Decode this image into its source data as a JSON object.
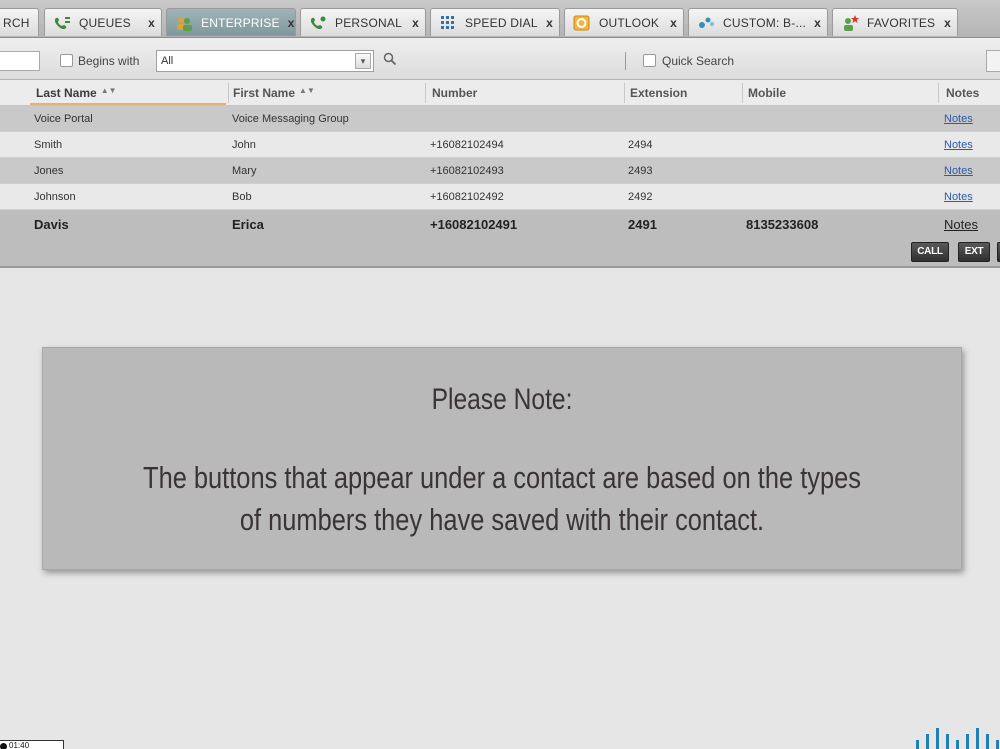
{
  "tabs": [
    {
      "label": "RCH",
      "icon": "search-icon",
      "active": false
    },
    {
      "label": "QUEUES",
      "icon": "queue-phone-icon",
      "active": false
    },
    {
      "label": "ENTERPRISE",
      "icon": "enterprise-people-icon",
      "active": true
    },
    {
      "label": "PERSONAL",
      "icon": "personal-phone-icon",
      "active": false
    },
    {
      "label": "SPEED DIAL",
      "icon": "keypad-icon",
      "active": false
    },
    {
      "label": "OUTLOOK",
      "icon": "outlook-icon",
      "active": false
    },
    {
      "label": "CUSTOM: B-...",
      "icon": "custom-group-icon",
      "active": false
    },
    {
      "label": "FAVORITES",
      "icon": "favorites-star-icon",
      "active": false
    }
  ],
  "tab_close": "x",
  "search": {
    "begins_with_label": "Begins with",
    "filter_value": "All",
    "quick_search_label": "Quick Search"
  },
  "table": {
    "headers": [
      "Last Name",
      "First Name",
      "Number",
      "Extension",
      "Mobile",
      "Notes"
    ],
    "rows": [
      {
        "last": "Voice Portal",
        "first": "Voice Messaging Group",
        "number": "",
        "ext": "",
        "mobile": "",
        "notes": "Notes"
      },
      {
        "last": "Smith",
        "first": "John",
        "number": "+16082102494",
        "ext": "2494",
        "mobile": "",
        "notes": "Notes"
      },
      {
        "last": "Jones",
        "first": "Mary",
        "number": "+16082102493",
        "ext": "2493",
        "mobile": "",
        "notes": "Notes"
      },
      {
        "last": "Johnson",
        "first": "Bob",
        "number": "+16082102492",
        "ext": "2492",
        "mobile": "",
        "notes": "Notes"
      },
      {
        "last": "Davis",
        "first": "Erica",
        "number": "+16082102491",
        "ext": "2491",
        "mobile": "8135233608",
        "notes": "Notes"
      }
    ],
    "actions": [
      "CALL",
      "EXT"
    ]
  },
  "note": {
    "title": "Please Note:",
    "body": "The buttons that appear under a contact are based on the types of numbers they have saved with their contact."
  },
  "timestamp": "01:40",
  "colors": {
    "accent_tab": "#8aa1a5",
    "link": "#2a5ca8",
    "sort_highlight": "#e8b26a"
  }
}
